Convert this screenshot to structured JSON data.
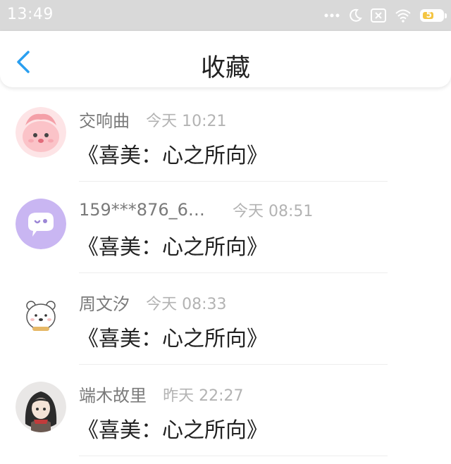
{
  "status_bar": {
    "time": "13:49",
    "battery": "57",
    "battery_level": 0.57,
    "icons": [
      "more-dots-icon",
      "moon-icon",
      "sim-x-icon",
      "wifi-icon",
      "battery-icon"
    ]
  },
  "header": {
    "back_icon": "chevron-left-icon",
    "title": "收藏"
  },
  "items": [
    {
      "name": "交响曲",
      "time": "今天 10:21",
      "title": "《喜美：心之所向》"
    },
    {
      "name": "159***876_6…",
      "time": "今天 08:51",
      "title": "《喜美：心之所向》"
    },
    {
      "name": "周文汐",
      "time": "今天 08:33",
      "title": "《喜美：心之所向》"
    },
    {
      "name": "端木故里",
      "time": "昨天 22:27",
      "title": "《喜美：心之所向》"
    }
  ],
  "colors": {
    "accent": "#2a9ff0",
    "statusbar_bg": "#d9d9d9",
    "name_text": "#7a7a7a",
    "time_text": "#b3b3b3",
    "title_text": "#222222"
  }
}
